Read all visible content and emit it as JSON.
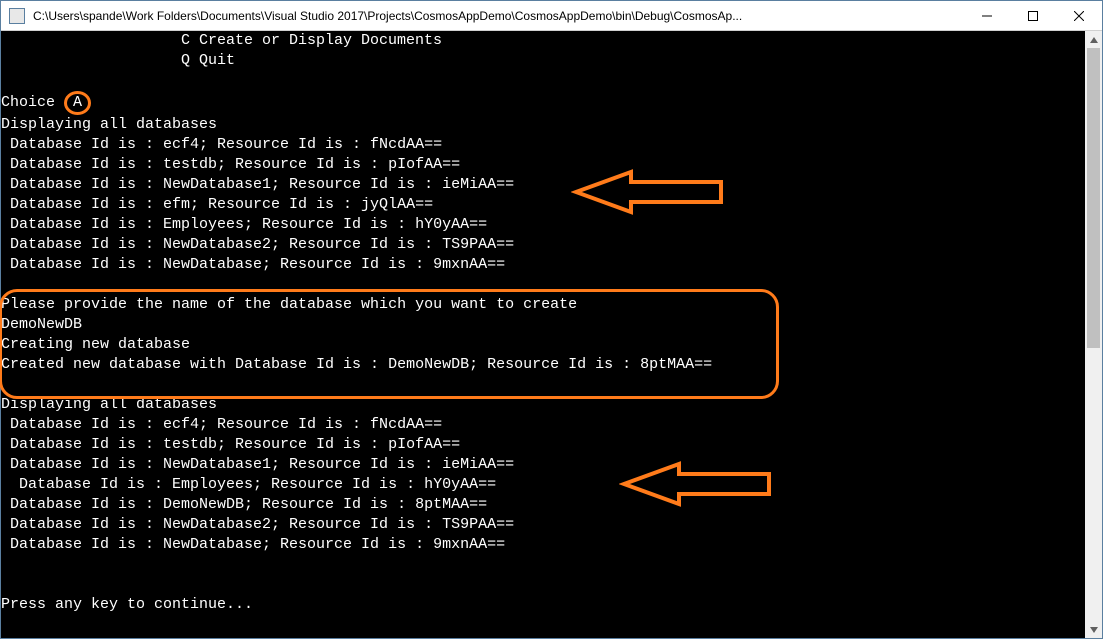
{
  "titlebar": {
    "path": "C:\\Users\\spande\\Work Folders\\Documents\\Visual Studio 2017\\Projects\\CosmosAppDemo\\CosmosAppDemo\\bin\\Debug\\CosmosAp..."
  },
  "menu": {
    "create": "C Create or Display Documents",
    "quit": "Q Quit"
  },
  "prompt": {
    "label": "Choice ",
    "value": "A"
  },
  "sections": {
    "display1_title": "Displaying all databases",
    "display1_rows": [
      " Database Id is : ecf4; Resource Id is : fNcdAA==",
      " Database Id is : testdb; Resource Id is : pIofAA==",
      " Database Id is : NewDatabase1; Resource Id is : ieMiAA==",
      " Database Id is : efm; Resource Id is : jyQlAA==",
      " Database Id is : Employees; Resource Id is : hY0yAA==",
      " Database Id is : NewDatabase2; Resource Id is : TS9PAA==",
      " Database Id is : NewDatabase; Resource Id is : 9mxnAA=="
    ],
    "create_prompt": "Please provide the name of the database which you want to create",
    "create_input": "DemoNewDB",
    "create_progress": "Creating new database",
    "create_result": "Created new database with Database Id is : DemoNewDB; Resource Id is : 8ptMAA==",
    "display2_title": "Displaying all databases",
    "display2_rows": [
      " Database Id is : ecf4; Resource Id is : fNcdAA==",
      " Database Id is : testdb; Resource Id is : pIofAA==",
      " Database Id is : NewDatabase1; Resource Id is : ieMiAA==",
      "  Database Id is : Employees; Resource Id is : hY0yAA==",
      " Database Id is : DemoNewDB; Resource Id is : 8ptMAA==",
      " Database Id is : NewDatabase2; Resource Id is : TS9PAA==",
      " Database Id is : NewDatabase; Resource Id is : 9mxnAA=="
    ],
    "footer": "Press any key to continue..."
  },
  "annotations": {
    "arrow_color": "#ff7b1a",
    "box_color": "#ff7b1a"
  }
}
